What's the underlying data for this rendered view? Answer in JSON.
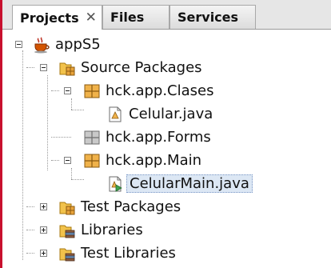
{
  "tabs": [
    {
      "label": "Projects",
      "active": true,
      "closable": true
    },
    {
      "label": "Files",
      "active": false,
      "closable": false
    },
    {
      "label": "Services",
      "active": false,
      "closable": false
    }
  ],
  "tab_close_glyph": "✕",
  "tree": {
    "project": {
      "label": "appS5",
      "icon": "coffee-cup-icon",
      "expanded": true
    },
    "source_packages": {
      "label": "Source Packages",
      "icon": "source-folder-icon",
      "expanded": true
    },
    "packages": [
      {
        "label": "hck.app.Clases",
        "icon": "package-icon",
        "expanded": true,
        "files": [
          {
            "label": "Celular.java",
            "icon": "java-class-icon"
          }
        ]
      },
      {
        "label": "hck.app.Forms",
        "icon": "empty-package-icon",
        "expanded": false,
        "files": []
      },
      {
        "label": "hck.app.Main",
        "icon": "package-icon",
        "expanded": true,
        "files": [
          {
            "label": "CelularMain.java",
            "icon": "java-main-class-icon",
            "selected": true
          }
        ]
      }
    ],
    "test_packages": {
      "label": "Test Packages",
      "icon": "test-folder-icon",
      "expanded": false
    },
    "libraries": {
      "label": "Libraries",
      "icon": "library-folder-icon",
      "expanded": false
    },
    "test_libraries": {
      "label": "Test Libraries",
      "icon": "library-folder-icon",
      "expanded": false
    }
  },
  "colors": {
    "selection_bg": "#dce7f4",
    "package_orange": "#e8a33a",
    "folder_yellow": "#f2c24b",
    "window_accent": "#c8102e"
  }
}
